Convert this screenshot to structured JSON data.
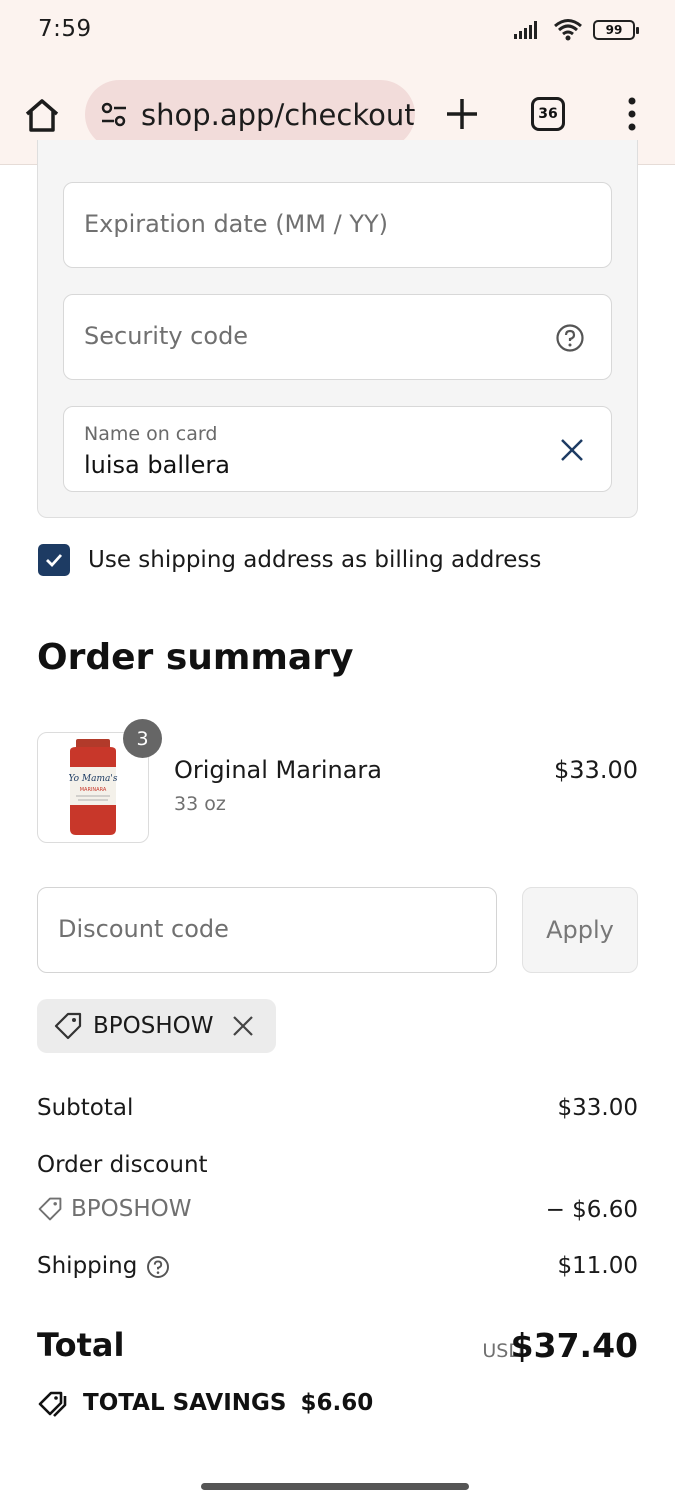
{
  "status_bar": {
    "time": "7:59",
    "battery": "99"
  },
  "browser": {
    "url": "shop.app/checkout",
    "tab_count": "36"
  },
  "payment": {
    "expiration_placeholder": "Expiration date (MM / YY)",
    "security_placeholder": "Security code",
    "name_label": "Name on card",
    "name_value": "luisa ballera"
  },
  "billing": {
    "checkbox_label": "Use shipping address as billing address",
    "checked": true
  },
  "order_summary": {
    "title": "Order summary",
    "item": {
      "name": "Original Marinara",
      "variant": "33 oz",
      "price": "$33.00",
      "quantity": "3"
    },
    "discount_placeholder": "Discount code",
    "apply_label": "Apply",
    "applied_code": "BPOSHOW",
    "subtotal_label": "Subtotal",
    "subtotal_value": "$33.00",
    "order_discount_label": "Order discount",
    "order_discount_code": "BPOSHOW",
    "order_discount_value": "− $6.60",
    "shipping_label": "Shipping",
    "shipping_value": "$11.00",
    "total_label": "Total",
    "total_currency": "USD",
    "total_value": "$37.40",
    "savings_label": "TOTAL SAVINGS",
    "savings_value": "$6.60"
  },
  "colors": {
    "accent": "#1d3b63",
    "toolbar_bg": "#fcf3ef",
    "url_pill": "#f2dcda"
  },
  "icons": [
    "home-icon",
    "tune-icon",
    "plus-icon",
    "tabs-icon",
    "more-vert-icon",
    "help-icon",
    "close-icon",
    "check-icon",
    "tag-icon",
    "tags-icon",
    "signal-icon",
    "wifi-icon",
    "battery-icon"
  ]
}
